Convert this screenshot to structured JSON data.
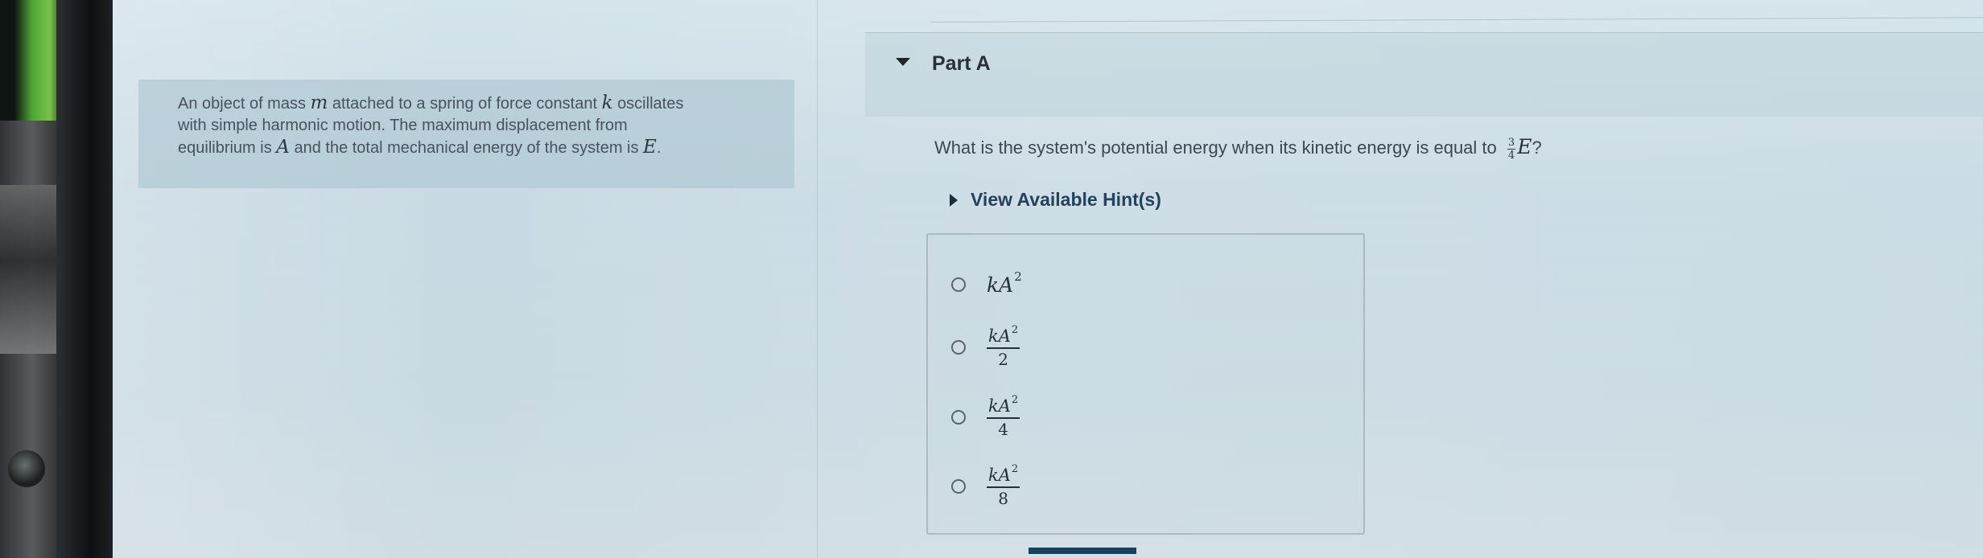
{
  "problem": {
    "text_before_m": "An object of mass",
    "mass_symbol": "m",
    "text_before_k": "attached to a spring of force constant",
    "spring_symbol": "k",
    "line1_end": "oscillates",
    "line2": "with simple harmonic motion. The maximum displacement from",
    "line3_before_a": "equilibrium is",
    "amplitude_symbol": "A",
    "line3_mid": "and the total mechanical energy of the system is",
    "energy_symbol": "E",
    "period": "."
  },
  "part": {
    "title": "Part A"
  },
  "question": {
    "text": "What is the system's potential energy when its kinetic energy is equal to",
    "fraction_numerator": "3",
    "fraction_denominator": "4",
    "energy_symbol": "E",
    "question_mark": "?"
  },
  "hints": {
    "label": "View Available Hint(s)"
  },
  "answers": [
    {
      "plain": "kA",
      "exponent": "2"
    },
    {
      "numerator": "kA",
      "exponent": "2",
      "denominator": "2"
    },
    {
      "numerator": "kA",
      "exponent": "2",
      "denominator": "4"
    },
    {
      "numerator": "kA",
      "exponent": "2",
      "denominator": "8"
    }
  ]
}
